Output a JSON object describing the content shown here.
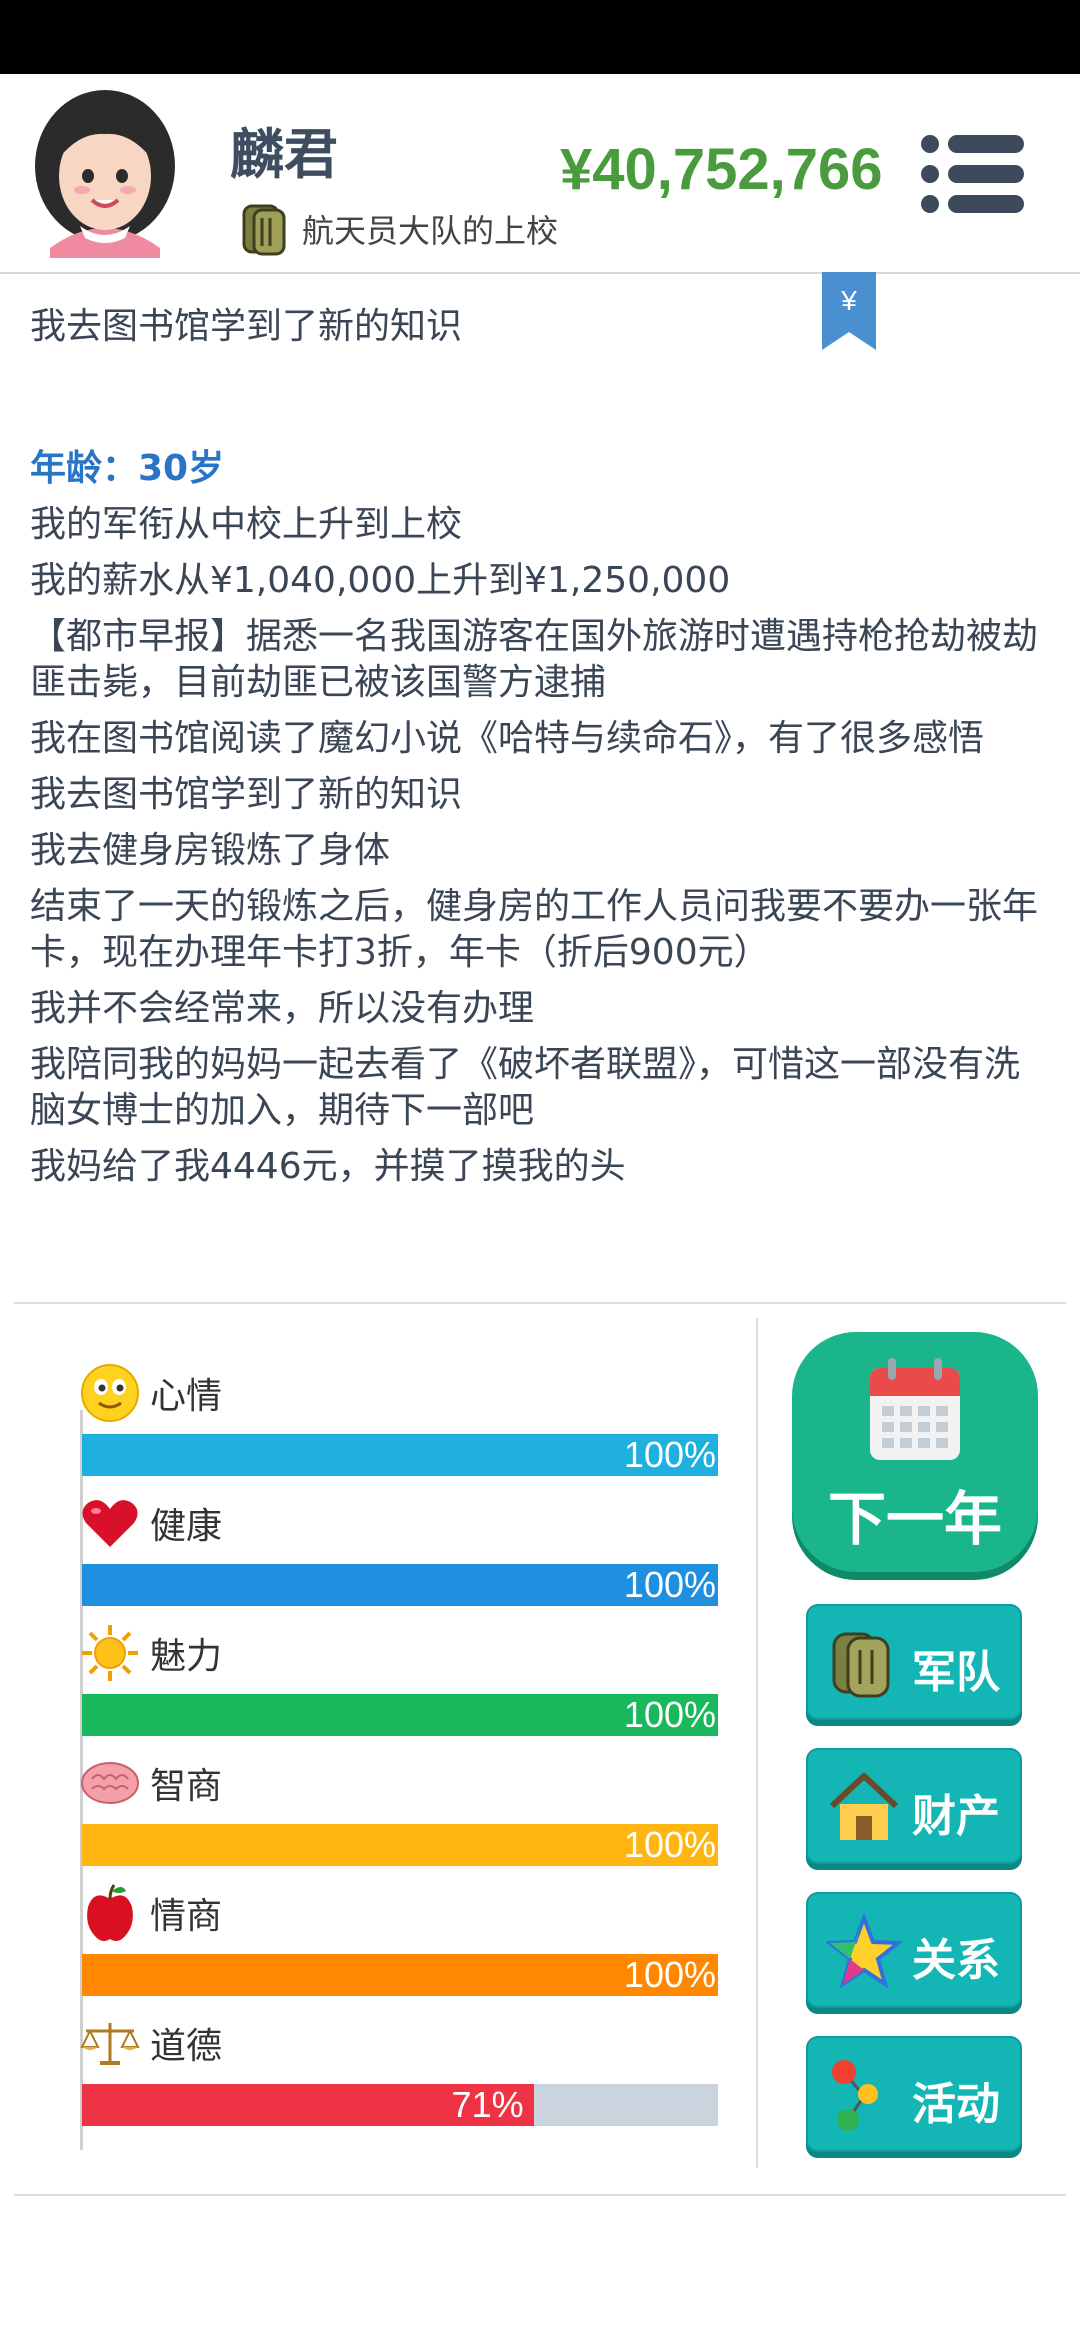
{
  "header": {
    "name": "麟君",
    "rank": "航天员大队的上校",
    "money": "¥40,752,766",
    "bookmark_symbol": "¥"
  },
  "log": {
    "lines_top": [
      "我去图书馆学到了新的知识"
    ],
    "age_title": "年龄：30岁",
    "lines": [
      "我的军衔从中校上升到上校",
      "我的薪水从¥1,040,000上升到¥1,250,000",
      "【都市早报】据悉一名我国游客在国外旅游时遭遇持枪抢劫被劫匪击毙，目前劫匪已被该国警方逮捕",
      "我在图书馆阅读了魔幻小说《哈特与续命石》，有了很多感悟",
      "我去图书馆学到了新的知识",
      "我去健身房锻炼了身体",
      "结束了一天的锻炼之后，健身房的工作人员问我要不要办一张年卡，现在办理年卡打3折，年卡（折后900元）",
      "我并不会经常来，所以没有办理",
      "我陪同我的妈妈一起去看了《破坏者联盟》，可惜这一部没有洗脑女博士的加入，期待下一部吧",
      "我妈给了我4446元，并摸了摸我的头"
    ]
  },
  "stats": [
    {
      "label": "心情",
      "icon": "smiley-icon",
      "value": 100,
      "pct": "100%",
      "color": "#1fb0e0"
    },
    {
      "label": "健康",
      "icon": "heart-icon",
      "value": 100,
      "pct": "100%",
      "color": "#1f8fe0"
    },
    {
      "label": "魅力",
      "icon": "sun-icon",
      "value": 100,
      "pct": "100%",
      "color": "#19b85c"
    },
    {
      "label": "智商",
      "icon": "brain-icon",
      "value": 100,
      "pct": "100%",
      "color": "#ffb612"
    },
    {
      "label": "情商",
      "icon": "apple-icon",
      "value": 100,
      "pct": "100%",
      "color": "#ff8800"
    },
    {
      "label": "道德",
      "icon": "scales-icon",
      "value": 71,
      "pct": "71%",
      "color": "#ee3344"
    }
  ],
  "actions": {
    "next_year": "下一年",
    "army": "军队",
    "property": "财产",
    "relations": "关系",
    "activities": "活动"
  }
}
